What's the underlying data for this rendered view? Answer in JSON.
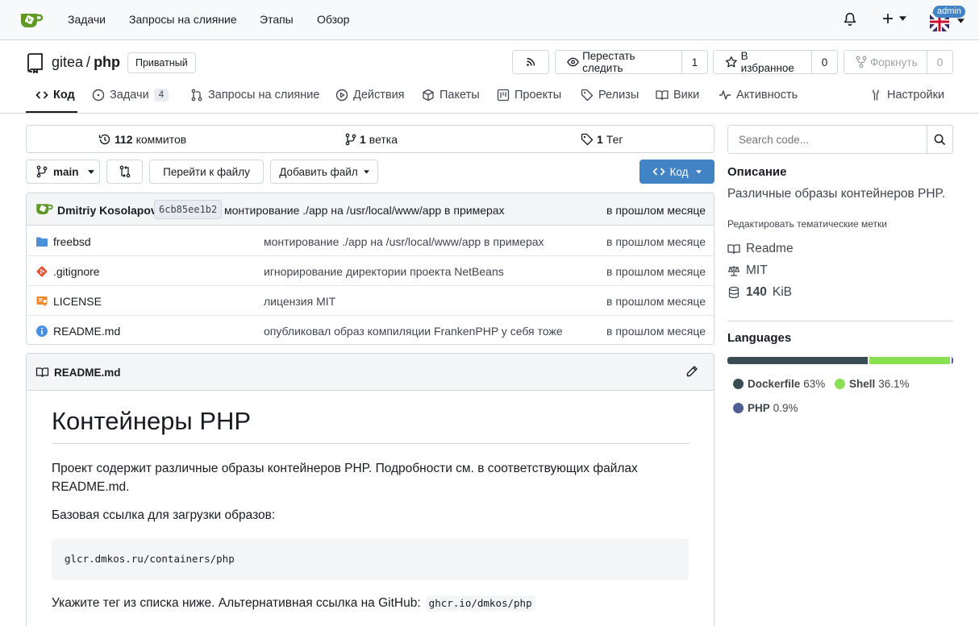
{
  "topnav": {
    "items": [
      "Задачи",
      "Запросы на слияние",
      "Этапы",
      "Обзор"
    ],
    "avatar_badge": "admin"
  },
  "repo": {
    "owner": "gitea",
    "separator": "/",
    "name": "php",
    "visibility": "Приватный",
    "unwatch_label": "Перестать следить",
    "watch_count": "1",
    "star_label": "В избранное",
    "star_count": "0",
    "fork_label": "Форкнуть",
    "fork_count": "0"
  },
  "tabs": [
    {
      "label": "Код",
      "icon": "code-icon"
    },
    {
      "label": "Задачи",
      "icon": "issue-icon",
      "count": "4"
    },
    {
      "label": "Запросы на слияние",
      "icon": "pull-request-icon"
    },
    {
      "label": "Действия",
      "icon": "play-icon"
    },
    {
      "label": "Пакеты",
      "icon": "package-icon"
    },
    {
      "label": "Проекты",
      "icon": "project-icon"
    },
    {
      "label": "Релизы",
      "icon": "tag-icon"
    },
    {
      "label": "Вики",
      "icon": "book-icon"
    },
    {
      "label": "Активность",
      "icon": "pulse-icon"
    },
    {
      "label": "Настройки",
      "icon": "tools-icon"
    }
  ],
  "stats": {
    "commits_num": "112",
    "commits_label": "коммитов",
    "branches_num": "1",
    "branches_label": "ветка",
    "tags_num": "1",
    "tags_label": "Тег"
  },
  "toolbar": {
    "branch": "main",
    "goto_file": "Перейти к файлу",
    "add_file": "Добавить файл",
    "code_button": "Код"
  },
  "last_commit": {
    "author": "Dmitriy Kosolapov",
    "sha": "6cb85ee1b2",
    "message": "монтирование ./app на /usr/local/www/app в примерах",
    "time": "в прошлом месяце"
  },
  "files": [
    {
      "name": "freebsd",
      "type": "folder",
      "message": "монтирование ./app на /usr/local/www/app в примерах",
      "time": "в прошлом месяце"
    },
    {
      "name": ".gitignore",
      "type": "git",
      "message": "игнорирование директории проекта NetBeans",
      "time": "в прошлом месяце"
    },
    {
      "name": "LICENSE",
      "type": "license",
      "message": "лицензия MIT",
      "time": "в прошлом месяце"
    },
    {
      "name": "README.md",
      "type": "info",
      "message": "опубликовал образ компиляции FrankenPHP у себя тоже",
      "time": "в прошлом месяце"
    }
  ],
  "readme": {
    "filename": "README.md",
    "heading": "Контейнеры PHP",
    "p1": "Проект содержит различные образы контейнеров PHP. Подробности см. в соответствующих файлах README.md.",
    "p2": "Базовая ссылка для загрузки образов:",
    "code": "glcr.dmkos.ru/containers/php",
    "p3": "Укажите тег из списка ниже. Альтернативная ссылка на GitHub:",
    "p3_code": "ghcr.io/dmkos/php"
  },
  "sidebar": {
    "search_placeholder": "Search code...",
    "description_title": "Описание",
    "description": "Различные образы контейнеров PHP.",
    "edit_topics": "Редактировать тематические метки",
    "readme": "Readme",
    "license": "MIT",
    "size_num": "140",
    "size_unit": "KiB",
    "languages_title": "Languages",
    "languages": [
      {
        "name": "Dockerfile",
        "percent": "63%",
        "value": 63,
        "color": "#384d54"
      },
      {
        "name": "Shell",
        "percent": "36.1%",
        "value": 36.1,
        "color": "#89e051"
      },
      {
        "name": "PHP",
        "percent": "0.9%",
        "value": 0.9,
        "color": "#4f5d95"
      }
    ]
  },
  "colors": {
    "primary": "#4183c4",
    "gitea_green": "#609926",
    "folder": "#4a8fd8"
  }
}
